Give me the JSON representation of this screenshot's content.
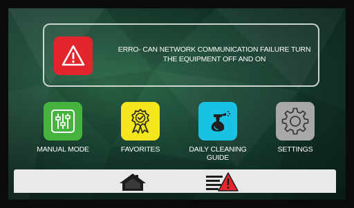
{
  "alert": {
    "message": "ERRO- CAN NETWORK COMMUNICATION FAILURE TURN THE EQUIPMENT OFF AND ON",
    "icon": "warning-triangle-icon",
    "color": "#e3262b"
  },
  "tiles": [
    {
      "label": "MANUAL MODE",
      "icon": "sliders-icon",
      "color": "#46b33f"
    },
    {
      "label": "FAVORITES",
      "icon": "award-ribbon-icon",
      "color": "#f4e61c"
    },
    {
      "label": "DAILY CLEANING GUIDE",
      "icon": "spray-bottle-icon",
      "color": "#19c1e3"
    },
    {
      "label": "SETTINGS",
      "icon": "gear-icon",
      "color": "#a8a8a8"
    }
  ],
  "bottom_bar": {
    "home_icon": "home-icon",
    "alarms_icon": "alarm-list-warning-icon",
    "warning_color": "#e3262b"
  }
}
